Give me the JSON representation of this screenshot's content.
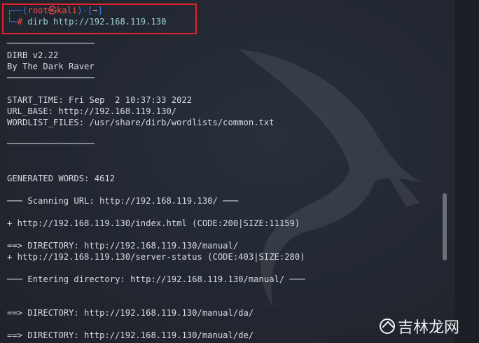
{
  "prompt": {
    "corner_top": "┌──(",
    "user": "root",
    "at_symbol": "㉿",
    "host": "kali",
    "dir_open": ")-[",
    "dir": "~",
    "dir_close": "]",
    "corner_bottom": "└─",
    "hash": "#",
    "command": " dirb http://192.168.119.130"
  },
  "output": {
    "rule1": "─────────────────",
    "banner1": "DIRB v2.22",
    "banner2": "By The Dark Raver",
    "rule2": "─────────────────",
    "start_time": "START_TIME: Fri Sep  2 10:37:33 2022",
    "url_base": "URL_BASE: http://192.168.119.130/",
    "wordlist": "WORDLIST_FILES: /usr/share/dirb/wordlists/common.txt",
    "rule3": "─────────────────",
    "generated": "GENERATED WORDS: 4612",
    "scanning": "─── Scanning URL: http://192.168.119.130/ ───",
    "hit_index": "+ http://192.168.119.130/index.html (CODE:200|SIZE:11159)",
    "dir_manual": "==> DIRECTORY: http://192.168.119.130/manual/",
    "hit_status": "+ http://192.168.119.130/server-status (CODE:403|SIZE:280)",
    "entering": "─── Entering directory: http://192.168.119.130/manual/ ───",
    "dir_da": "==> DIRECTORY: http://192.168.119.130/manual/da/",
    "dir_de": "==> DIRECTORY: http://192.168.119.130/manual/de/"
  },
  "watermark": {
    "text": "吉林龙网"
  }
}
